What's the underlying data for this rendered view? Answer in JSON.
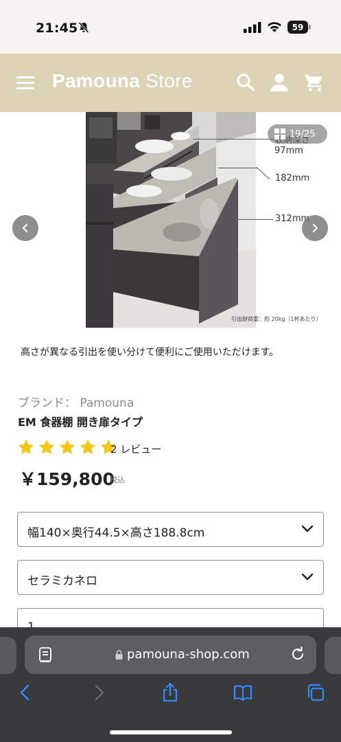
{
  "status_bar": {
    "time": "21:45",
    "battery": "59",
    "icons": [
      "bell-off-icon",
      "cellular-signal-icon",
      "wifi-icon",
      "battery-icon"
    ]
  },
  "header": {
    "logo_name": "Pamouna",
    "logo_suffix": "Store",
    "background": "#ddd4b7",
    "icons": [
      "hamburger-menu-icon",
      "search-icon",
      "account-icon",
      "cart-icon"
    ]
  },
  "gallery": {
    "counter": "19/25",
    "dimension_labels": [
      "収納深さ97mm",
      "182mm",
      "312mm"
    ],
    "load_note": "引出耐荷重：約 20kg（1杯あたり）",
    "caption": "高さが異なる引出を使い分けて便利にご使用いただけます。"
  },
  "product": {
    "brand": "ブランド： Pamouna",
    "title": "EM 食器棚 開き扉タイプ",
    "rating": 5,
    "star_color": "#f5c518",
    "review_count": "2 レビュー",
    "price": "￥159,800",
    "tax_note": "税込"
  },
  "options": {
    "size": "幅140×奥行44.5×高さ188.8cm",
    "color": "セラミカネロ",
    "quantity": "1"
  },
  "browser": {
    "url": "pamouna-shop.com",
    "toolbar_icons": [
      "back-icon",
      "forward-icon",
      "share-icon",
      "bookmarks-icon",
      "tabs-icon"
    ]
  }
}
